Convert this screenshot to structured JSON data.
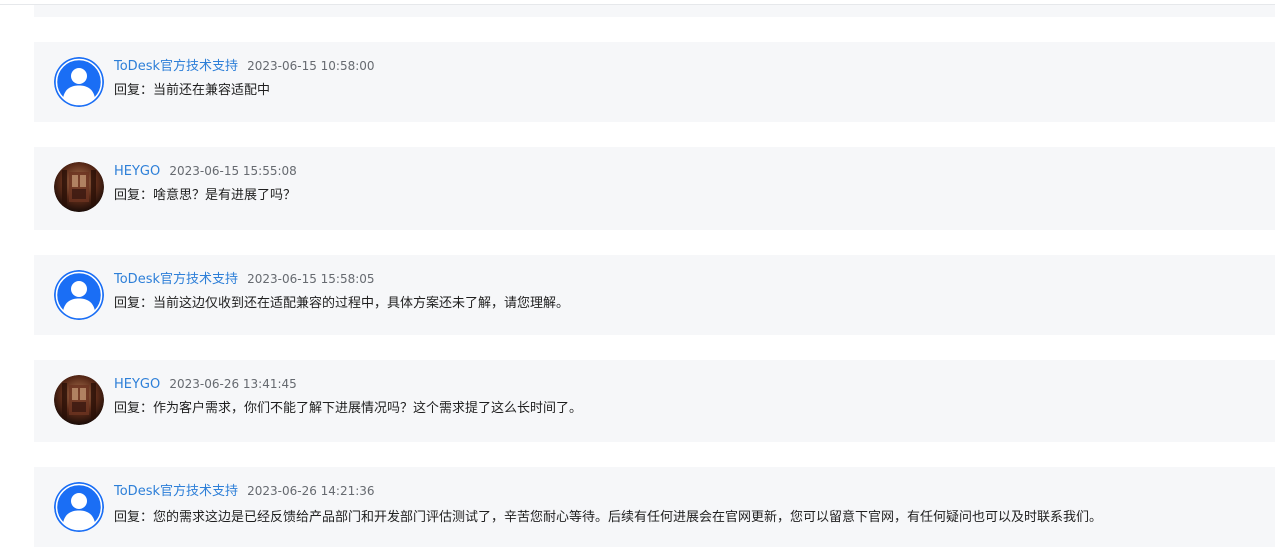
{
  "comments": [
    {
      "author": "ToDesk官方技术支持",
      "time": "2023-06-15 10:58:00",
      "text": "回复：当前还在兼容适配中",
      "avatar": "default-user-icon",
      "avatar_color": "#1a6ef5"
    },
    {
      "author": "HEYGO",
      "time": "2023-06-15 15:55:08",
      "text": "回复：啥意思？是有进展了吗？",
      "avatar": "photo-avatar",
      "avatar_color": "#3a1d12"
    },
    {
      "author": "ToDesk官方技术支持",
      "time": "2023-06-15 15:58:05",
      "text": "回复：当前这边仅收到还在适配兼容的过程中，具体方案还未了解，请您理解。",
      "avatar": "default-user-icon",
      "avatar_color": "#1a6ef5"
    },
    {
      "author": "HEYGO",
      "time": "2023-06-26 13:41:45",
      "text": "回复：作为客户需求，你们不能了解下进展情况吗？这个需求提了这么长时间了。",
      "avatar": "photo-avatar",
      "avatar_color": "#3a1d12"
    },
    {
      "author": "ToDesk官方技术支持",
      "time": "2023-06-26 14:21:36",
      "text": "回复：您的需求这边是已经反馈给产品部门和开发部门评估测试了，辛苦您耐心等待。后续有任何进展会在官网更新，您可以留意下官网，有任何疑问也可以及时联系我们。",
      "avatar": "default-user-icon",
      "avatar_color": "#1a6ef5"
    }
  ],
  "colors": {
    "author": "#2d7fd8",
    "time": "#666a70",
    "text": "#1f1f1f",
    "card_bg": "#f6f7f9"
  }
}
